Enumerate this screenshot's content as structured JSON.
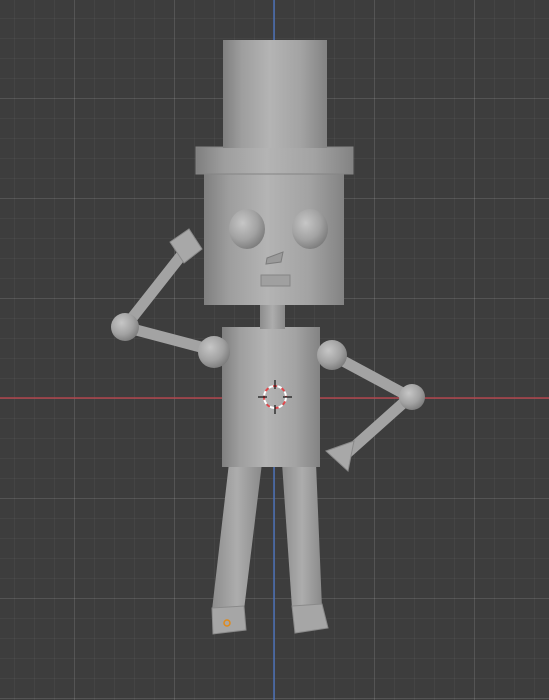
{
  "viewport": {
    "background_color": "#3d3d3d",
    "x_axis_color": "#b0454d",
    "y_axis_color": "#4a6fb5",
    "model_color": "#a9a9a9"
  },
  "scene": {
    "objects": [
      "hat",
      "head",
      "eyes",
      "nose",
      "mouth",
      "neck",
      "body",
      "arms",
      "hands",
      "legs",
      "feet"
    ]
  },
  "overlays": {
    "cursor": "3d-cursor-icon",
    "origin": "origin-point-icon"
  }
}
